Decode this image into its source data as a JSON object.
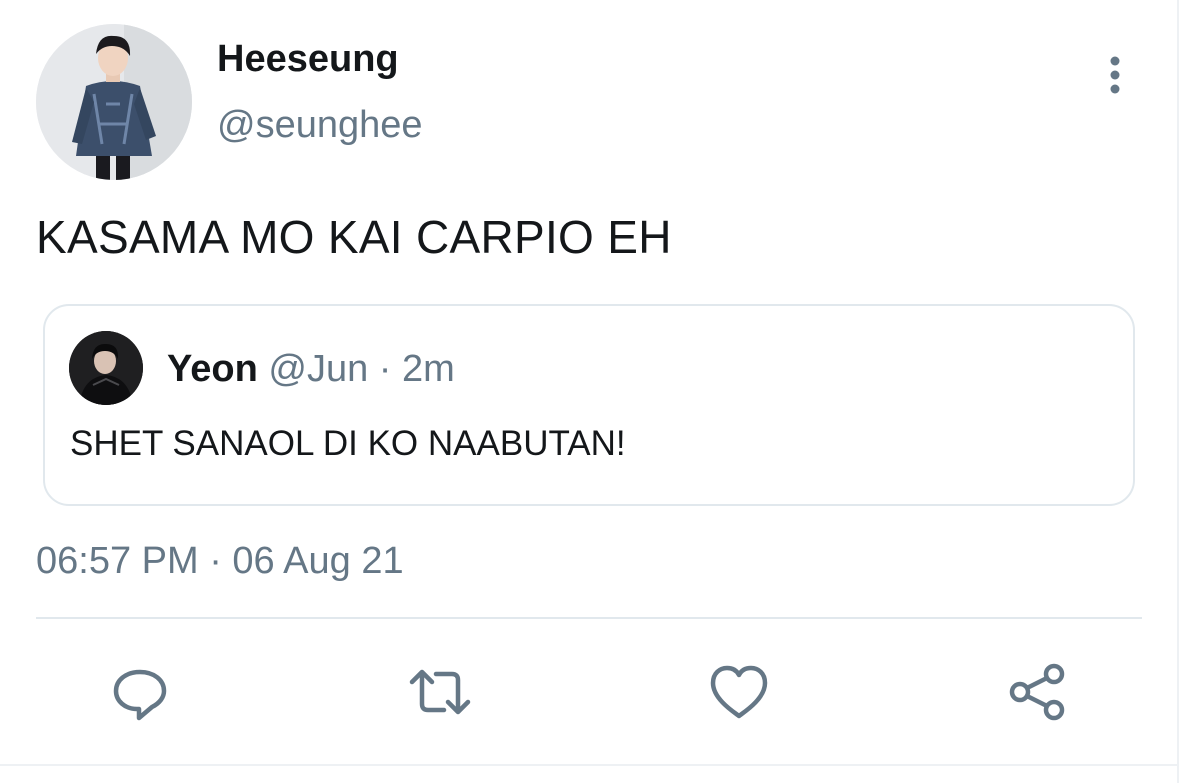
{
  "tweet": {
    "display_name": "Heeseung",
    "handle": "@seunghee",
    "text": "KASAMA MO KAI CARPIO EH",
    "timestamp": "06:57 PM · 06 Aug 21"
  },
  "quoted_tweet": {
    "display_name": "Yeon",
    "handle": "@Jun",
    "separator": " · ",
    "age": "2m",
    "text": "SHET SANAOL DI KO NAABUTAN!"
  },
  "actions": [
    {
      "icon": "reply-icon"
    },
    {
      "icon": "retweet-icon"
    },
    {
      "icon": "like-icon"
    },
    {
      "icon": "share-icon"
    }
  ],
  "colors": {
    "text_primary": "#14171a",
    "text_secondary": "#657786",
    "border": "#e1e8ed"
  }
}
